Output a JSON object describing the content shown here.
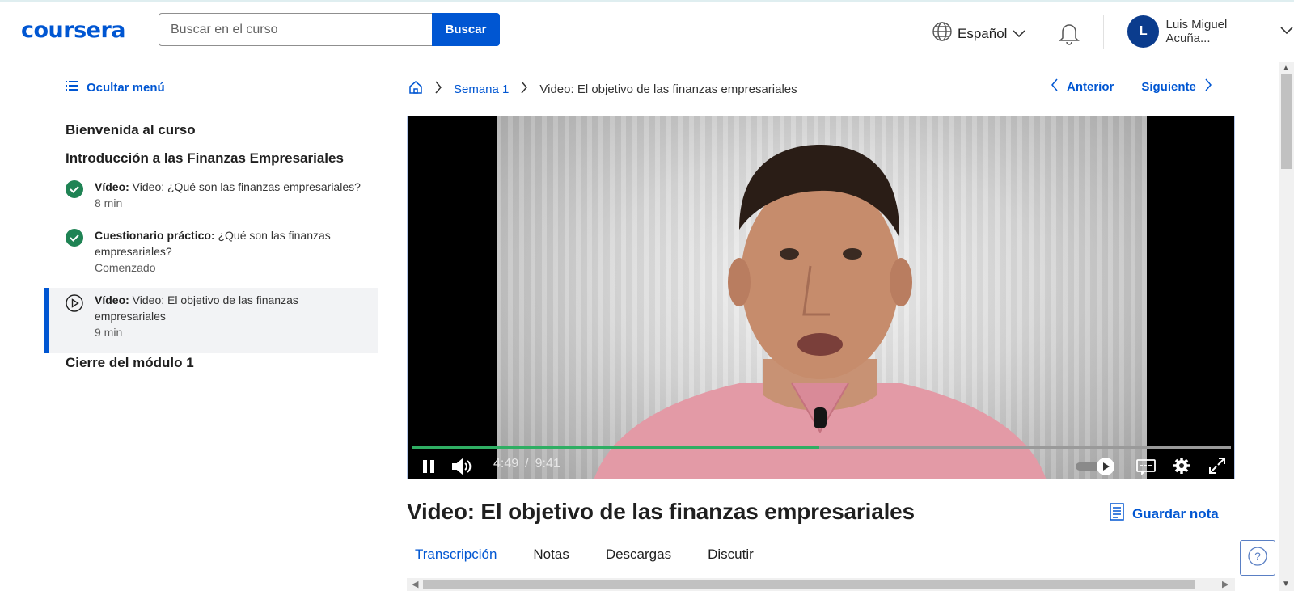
{
  "header": {
    "logo": "coursera",
    "search_placeholder": "Buscar en el curso",
    "search_button": "Buscar",
    "language": "Español",
    "user_initial": "L",
    "user_name": "Luis Miguel Acuña..."
  },
  "sidebar": {
    "hide_menu": "Ocultar menú",
    "sections": [
      "Bienvenida al curso",
      "Introducción a las Finanzas Empresariales",
      "Cierre del módulo 1"
    ],
    "items": [
      {
        "type": "Vídeo:",
        "title": "Video: ¿Qué son las finanzas empresariales?",
        "meta": "8 min",
        "status": "completed"
      },
      {
        "type": "Cuestionario práctico:",
        "title": "¿Qué son las finanzas empresariales?",
        "meta": "Comenzado",
        "status": "completed"
      },
      {
        "type": "Vídeo:",
        "title": "Video: El objetivo de las finanzas empresariales",
        "meta": "9 min",
        "status": "current"
      }
    ]
  },
  "breadcrumb": {
    "week": "Semana 1",
    "current": "Video: El objetivo de las finanzas empresariales"
  },
  "nav": {
    "prev": "Anterior",
    "next": "Siguiente"
  },
  "player": {
    "current_time": "4:49",
    "separator": "/",
    "duration": "9:41",
    "progress_fraction": 0.497,
    "accent_color": "#2fae63"
  },
  "content": {
    "title": "Video: El objetivo de las finanzas empresariales",
    "save_note": "Guardar nota",
    "tabs": [
      "Transcripción",
      "Notas",
      "Descargas",
      "Discutir"
    ],
    "active_tab": 0
  },
  "colors": {
    "brand": "#0056d2",
    "completed": "#1f8354"
  }
}
